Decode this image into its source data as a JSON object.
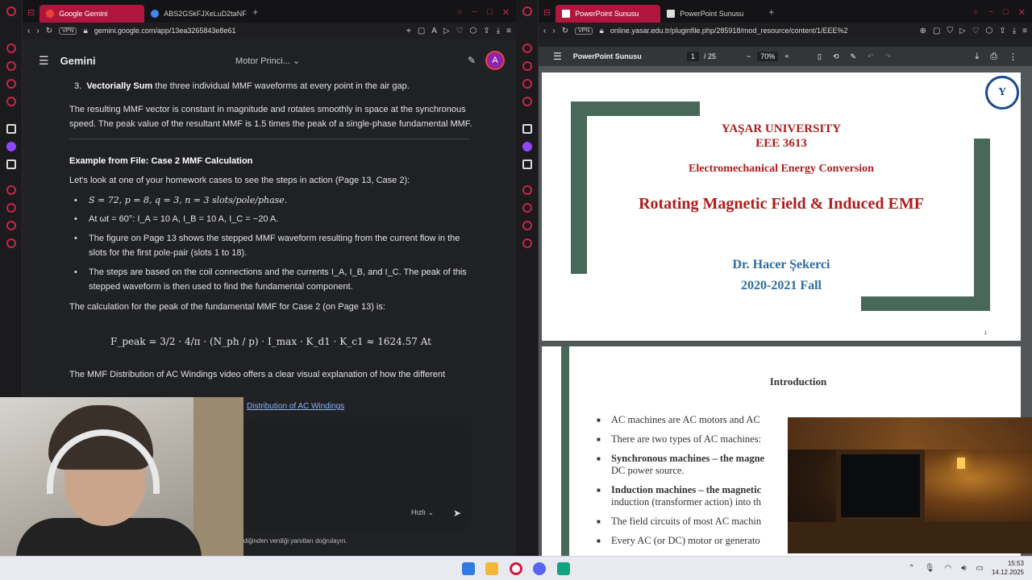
{
  "left_window": {
    "tabs": [
      {
        "label": "Google Gemini",
        "active": true
      },
      {
        "label": "ABS2GSkFJXeLuD2taNF",
        "active": false
      }
    ],
    "address": {
      "vpn": "VPN",
      "url": "gemini.google.com/app/13ea3265843e8e61"
    },
    "gemini": {
      "app_title": "Gemini",
      "conversation_title": "Motor Princi...",
      "avatar_letter": "A",
      "step3_num": "3.",
      "step3_bold": "Vectorially Sum",
      "step3_text": " the three individual MMF waveforms at every point in the air gap.",
      "result_para": "The resulting MMF vector is constant in magnitude and rotates smoothly in space at the synchronous speed. The peak value of the resultant MMF is 1.5 times the peak of a single-phase fundamental MMF.",
      "example_heading": "Example from File: Case 2 MMF Calculation",
      "example_intro": "Let's look at one of your homework cases to see the steps in action (Page 13, Case 2):",
      "bullets": [
        "S = 72, p = 8, q = 3, n = 3 slots/pole/phase.",
        "At ωt = 60°: I_A = 10 A, I_B = 10 A, I_C = −20 A.",
        "The figure on Page 13 shows the stepped MMF waveform resulting from the current flow in the slots for the first pole-pair (slots 1 to 18).",
        "The steps are based on the coil connections and the currents I_A, I_B, and I_C. The peak of this stepped waveform is then used to find the fundamental component."
      ],
      "calc_intro": "The calculation for the peak of the fundamental MMF for Case 2 (on Page 13) is:",
      "formula": "F_peak = 3/2 · 4/π · (N_ph / p) · I_max · K_d1 · K_c1 ≈ 1624.57 At",
      "video_para": "The MMF Distribution of AC Windings video offers a clear visual explanation of how the different",
      "video_link": "Distribution of AC Windings",
      "speed_label": "Hızlı",
      "disclaimer": "diğinden verdiği yanıtları doğrulayın."
    }
  },
  "right_window": {
    "tabs": [
      {
        "label": "PowerPoint Sunusu",
        "active": true
      },
      {
        "label": "PowerPoint Sunusu",
        "active": false
      }
    ],
    "address": {
      "vpn": "VPN",
      "url": "online.yasar.edu.tr/pluginfile.php/285918/mod_resource/content/1/EEE%2"
    },
    "pdf": {
      "doc_title": "PowerPoint Sunusu",
      "current_page": "1",
      "total_pages": "/ 25",
      "zoom": "70%",
      "slide1": {
        "university": "YAŞAR UNIVERSITY",
        "course": "EEE 3613",
        "subtitle": "Electromechanical Energy Conversion",
        "title": "Rotating Magnetic Field & Induced EMF",
        "author": "Dr. Hacer Şekerci",
        "term": "2020-2021 Fall",
        "page_num": "1"
      },
      "slide2": {
        "title": "Introduction",
        "bullets": [
          "AC machines are AC motors and AC",
          "There are two types of AC machines:",
          "Synchronous machines – the magne",
          "DC power source.",
          "Induction machines – the magnetic",
          "induction (transformer action) into th",
          "The field circuits of most AC machin",
          "Every AC (or DC) motor or generato"
        ]
      }
    }
  },
  "taskbar": {
    "time": "15:53",
    "date": "14.12.2025"
  },
  "colors": {
    "opera_red": "#c8234a",
    "tab_active": "#b0163d",
    "slide_green": "#48695a",
    "slide_red": "#b01c1c",
    "slide_blue": "#2e6da4"
  }
}
